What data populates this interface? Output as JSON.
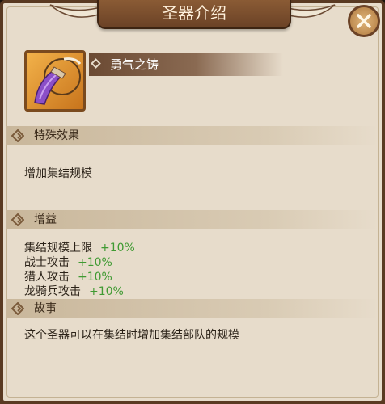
{
  "dialog": {
    "title": "圣器介绍",
    "close_icon": "close-x-icon"
  },
  "item": {
    "name": "勇气之铸",
    "icon": "purple-horn-artifact-icon"
  },
  "sections": {
    "special": {
      "title": "特殊效果",
      "text": "增加集结规模"
    },
    "buffs": {
      "title": "增益",
      "rows": [
        {
          "label": "集结规模上限",
          "value": "+10%"
        },
        {
          "label": "战士攻击",
          "value": "+10%"
        },
        {
          "label": "猎人攻击",
          "value": "+10%"
        },
        {
          "label": "龙骑兵攻击",
          "value": "+10%"
        }
      ]
    },
    "story": {
      "title": "故事",
      "text": "这个圣器可以在集结时增加集结部队的规模"
    }
  },
  "colors": {
    "panel_bg": "#e7dccb",
    "frame": "#5a3a22",
    "positive_value": "#3f9a32"
  }
}
